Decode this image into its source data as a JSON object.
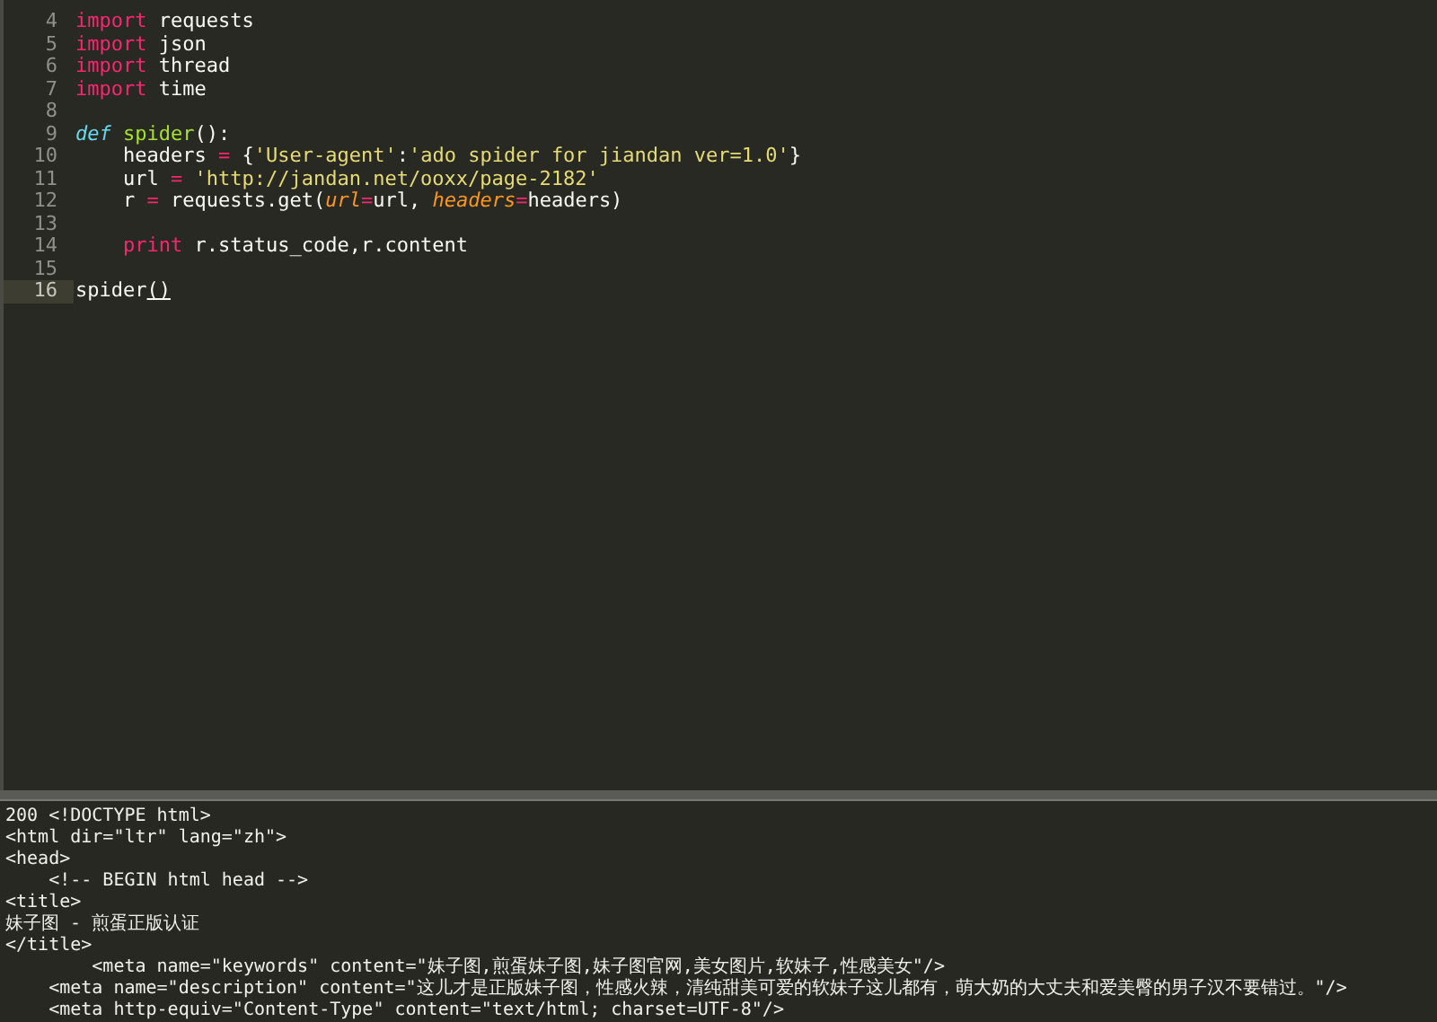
{
  "editor": {
    "lines": [
      {
        "number": "4",
        "current": false,
        "tokens": [
          {
            "kind": "kw",
            "text": "import"
          },
          {
            "kind": "plain",
            "text": " requests"
          }
        ]
      },
      {
        "number": "5",
        "current": false,
        "tokens": [
          {
            "kind": "kw",
            "text": "import"
          },
          {
            "kind": "plain",
            "text": " json"
          }
        ]
      },
      {
        "number": "6",
        "current": false,
        "tokens": [
          {
            "kind": "kw",
            "text": "import"
          },
          {
            "kind": "plain",
            "text": " thread"
          }
        ]
      },
      {
        "number": "7",
        "current": false,
        "tokens": [
          {
            "kind": "kw",
            "text": "import"
          },
          {
            "kind": "plain",
            "text": " time"
          }
        ]
      },
      {
        "number": "8",
        "current": false
      },
      {
        "number": "9",
        "current": false,
        "tokens": [
          {
            "kind": "def",
            "text": "def "
          },
          {
            "kind": "fn",
            "text": "spider"
          },
          {
            "kind": "plain",
            "text": "():"
          }
        ]
      },
      {
        "number": "10",
        "current": false,
        "tokens": [
          {
            "kind": "plain",
            "text": "    headers "
          },
          {
            "kind": "op",
            "text": "="
          },
          {
            "kind": "plain",
            "text": " {"
          },
          {
            "kind": "str",
            "text": "'User-agent'"
          },
          {
            "kind": "plain",
            "text": ":"
          },
          {
            "kind": "str",
            "text": "'ado spider for jiandan ver=1.0'"
          },
          {
            "kind": "plain",
            "text": "}"
          }
        ]
      },
      {
        "number": "11",
        "current": false,
        "tokens": [
          {
            "kind": "plain",
            "text": "    url "
          },
          {
            "kind": "op",
            "text": "="
          },
          {
            "kind": "str",
            "text": " 'http://jandan.net/ooxx/page-2182'"
          }
        ]
      },
      {
        "number": "12",
        "current": false,
        "tokens": [
          {
            "kind": "plain",
            "text": "    r "
          },
          {
            "kind": "op",
            "text": "="
          },
          {
            "kind": "plain",
            "text": " requests.get("
          },
          {
            "kind": "param",
            "text": "url"
          },
          {
            "kind": "op",
            "text": "="
          },
          {
            "kind": "plain",
            "text": "url, "
          },
          {
            "kind": "param",
            "text": "headers"
          },
          {
            "kind": "op",
            "text": "="
          },
          {
            "kind": "plain",
            "text": "headers)"
          }
        ]
      },
      {
        "number": "13",
        "current": false
      },
      {
        "number": "14",
        "current": false,
        "tokens": [
          {
            "kind": "kw",
            "text": "    print"
          },
          {
            "kind": "plain",
            "text": " r.status_code,r.content"
          }
        ]
      },
      {
        "number": "15",
        "current": false
      },
      {
        "number": "16",
        "current": true,
        "tokens": [
          {
            "kind": "plain",
            "text": "spider"
          },
          {
            "kind": "bracket",
            "text": "()"
          }
        ]
      }
    ]
  },
  "output": {
    "lines": [
      "200 <!DOCTYPE html>",
      "<html dir=\"ltr\" lang=\"zh\">",
      "<head>",
      "    <!-- BEGIN html head -->",
      "<title>",
      "妹子图 - 煎蛋正版认证",
      "</title>",
      "        <meta name=\"keywords\" content=\"妹子图,煎蛋妹子图,妹子图官网,美女图片,软妹子,性感美女\"/>",
      "    <meta name=\"description\" content=\"这儿才是正版妹子图，性感火辣，清纯甜美可爱的软妹子这儿都有，萌大奶的大丈夫和爱美臀的男子汉不要错过。\"/>",
      "    <meta http-equiv=\"Content-Type\" content=\"text/html; charset=UTF-8\"/>"
    ]
  }
}
